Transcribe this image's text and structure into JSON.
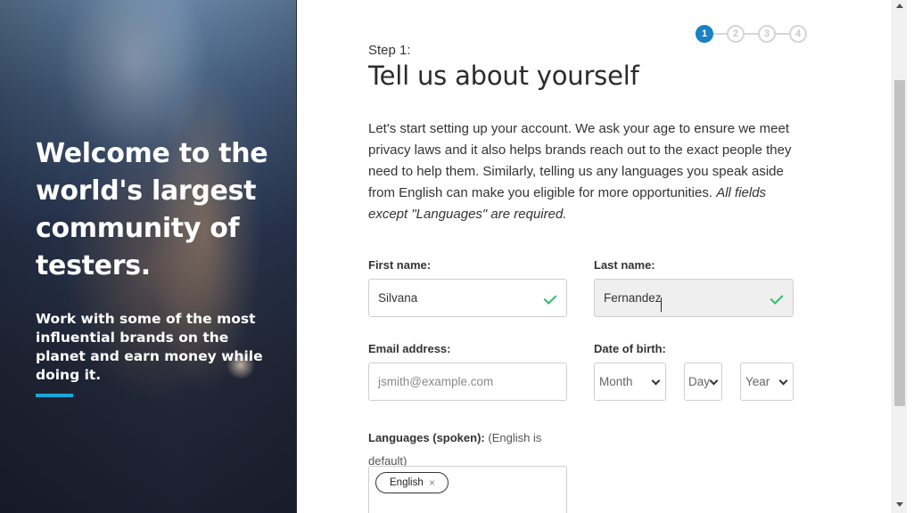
{
  "hero": {
    "title": "Welcome to the world's largest community of testers.",
    "subtitle": "Work with some of the most influential brands on the planet and earn money while doing it.",
    "accent_color": "#1aa6d9"
  },
  "stepper": {
    "steps": [
      "1",
      "2",
      "3",
      "4"
    ],
    "active_step": 1,
    "active_color": "#1a82c4"
  },
  "header": {
    "step_label": "Step 1:",
    "title": "Tell us about yourself"
  },
  "intro": {
    "text": "Let's start setting up your account. We ask your age to ensure we meet privacy laws and it also helps brands reach out to the exact people they need to help them. Similarly, telling us any languages you speak aside from English can make you eligible for more opportunities. ",
    "emphasis": "All fields except \"Languages\" are required."
  },
  "form": {
    "first_name": {
      "label": "First name:",
      "value": "Silvana",
      "valid": true
    },
    "last_name": {
      "label": "Last name:",
      "value": "Fernandez",
      "valid": true
    },
    "email": {
      "label": "Email address:",
      "value": "",
      "placeholder": "jsmith@example.com"
    },
    "dob": {
      "label": "Date of birth:",
      "month": "Month",
      "day": "Day",
      "year": "Year"
    },
    "languages": {
      "label": "Languages (spoken):",
      "note": "(English is default)",
      "tags": [
        "English"
      ],
      "remove_glyph": "×"
    },
    "valid_color": "#2ebd6b"
  },
  "scrollbar": {
    "thumb_start": 0.16,
    "thumb_fraction": 0.64
  }
}
